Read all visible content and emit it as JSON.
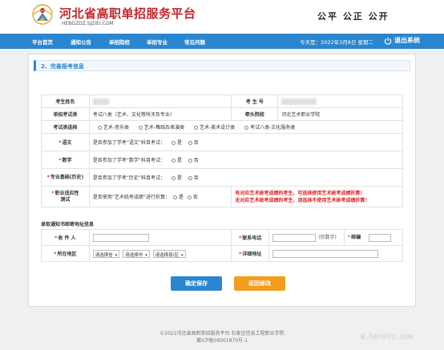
{
  "header": {
    "site_title": "河北省高职单招服务平台",
    "site_domain": "HEBGZDZ.SJZIEI.COM",
    "slogan": "公平  公正  公开"
  },
  "nav": {
    "items": [
      "平台首页",
      "通知公告",
      "单招院校",
      "单招专业",
      "常见问题"
    ],
    "date_text": "今天是：2022年3月8日 星期二",
    "logout": "退出系统"
  },
  "step": {
    "title": "2、完善报考信息"
  },
  "form": {
    "name_label": "考生姓名",
    "exam_no_label": "考 生 号",
    "category_label": "单招考试类",
    "category_value": "考试八类（艺术、文化等所涉及专业）",
    "school_label": "牵头院校",
    "school_value": "河北艺术职业学院",
    "select_label": "考试类选择",
    "select_options": [
      "艺术-音乐类",
      "艺术-舞蹈及表演类",
      "艺术-美术设计类",
      "考试八类-文化服务类"
    ],
    "yes": "是",
    "no": "否",
    "rows": [
      {
        "label": "语文",
        "question": "是否参加了学考“语文”科目考试："
      },
      {
        "label": "数学",
        "question": "是否参加了学考“数学”科目考试："
      },
      {
        "label": "专业基础(历史)",
        "question": "是否参加了学考“历史”科目考试："
      }
    ],
    "skill_label_1": "职业适应性",
    "skill_label_2": "测试",
    "skill_question": "是否使用“艺术统考成绩”进行折算：",
    "warning_1": "有对应艺术统考成绩的考生，可选择使用艺术统考成绩折算！",
    "warning_2": "无对应艺术统考成绩的考生，须选择不使用艺术统考成绩折算！"
  },
  "mail": {
    "section_label": "录取通知书邮寄地址信息",
    "recipient_label": "收 件 人",
    "phone_label": "联系电话",
    "phone_hint": "(仅数字)",
    "postcode_label": "邮编",
    "region_label": "所在地区",
    "province_placeholder": "请选择省",
    "city_placeholder": "请选择市",
    "county_placeholder": "请选择县/区",
    "address_label": "详细地址"
  },
  "buttons": {
    "save": "确定保存",
    "back": "返回修改"
  },
  "footer": {
    "line1": "©2022河北省高职单招服务平台  石家庄信息工程职业学院",
    "line2": "冀ICP备06001870号-1"
  },
  "watermark": "m.herots.com",
  "colors": {
    "brand_blue": "#2a86cf",
    "brand_red": "#c2262b",
    "save_button": "#2a86cf",
    "back_button": "#f29d1e",
    "warning": "#e02020"
  }
}
